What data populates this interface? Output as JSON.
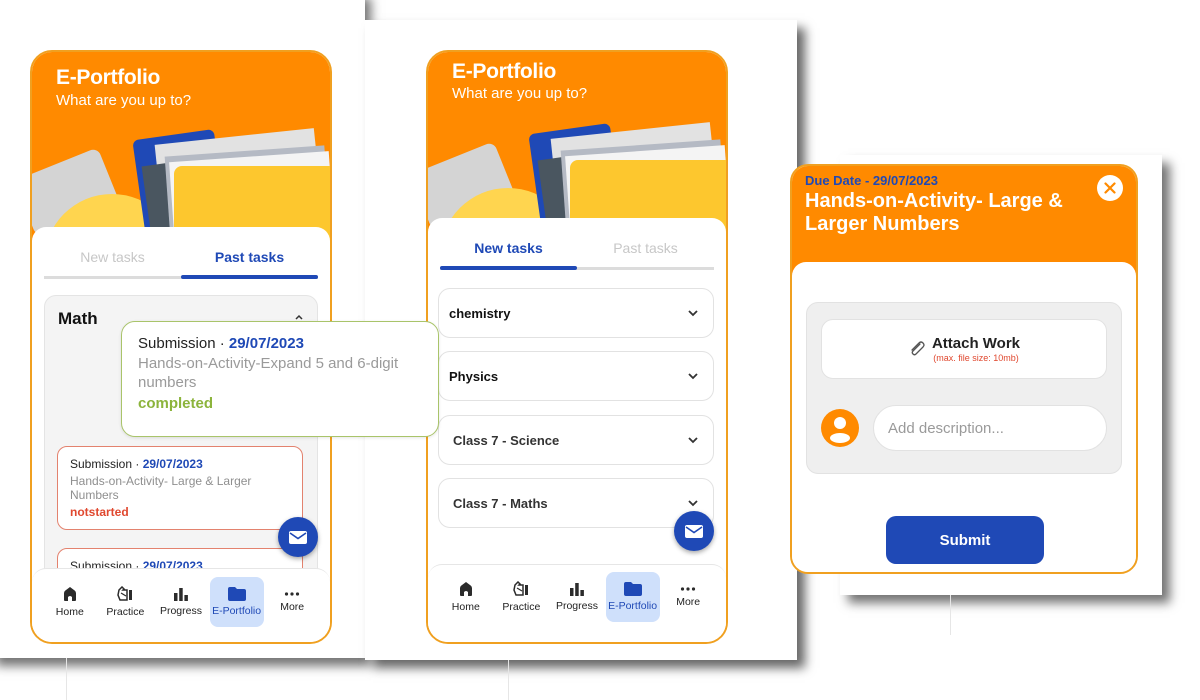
{
  "screens": [
    {
      "header": {
        "title": "E-Portfolio",
        "subtitle": "What are you up to?"
      },
      "tabs": [
        {
          "label": "New tasks",
          "active": false
        },
        {
          "label": "Past tasks",
          "active": true
        }
      ],
      "section": {
        "title": "Math",
        "expanded": true,
        "submissions": [
          {
            "prefix": "Submission · ",
            "date": "29/07/2023",
            "name": "Hands-on-Activity-Expand 5 and 6-digit numbers",
            "status": "completed"
          },
          {
            "prefix": "Submission · ",
            "date": "29/07/2023",
            "name": "Hands-on-Activity- Large & Larger Numbers",
            "status": "notstarted"
          },
          {
            "prefix": "Submission · ",
            "date": "29/07/2023",
            "name": "",
            "status": ""
          }
        ]
      },
      "fab_icon": "mail-icon"
    },
    {
      "header": {
        "title": "E-Portfolio",
        "subtitle": "What are you up to?"
      },
      "tabs": [
        {
          "label": "New tasks",
          "active": true
        },
        {
          "label": "Past tasks",
          "active": false
        }
      ],
      "subjects": [
        {
          "label": "chemistry"
        },
        {
          "label": "Physics"
        },
        {
          "label": "Class 7 - Science"
        },
        {
          "label": "Class 7 - Maths"
        }
      ],
      "fab_icon": "mail-icon"
    }
  ],
  "bottom_nav": [
    {
      "label": "Home",
      "icon": "home-icon",
      "active": false
    },
    {
      "label": "Practice",
      "icon": "practice-icon",
      "active": false
    },
    {
      "label": "Progress",
      "icon": "bar-chart-icon",
      "active": false
    },
    {
      "label": "E-Portfolio",
      "icon": "folder-icon",
      "active": true
    },
    {
      "label": "More",
      "icon": "more-dots-icon",
      "active": false
    }
  ],
  "modal": {
    "due_date": "Due Date - 29/07/2023",
    "title": "Hands-on-Activity- Large & Larger Numbers",
    "attach_label": "Attach Work",
    "attach_note": "(max. file size: 10mb)",
    "description_placeholder": "Add description...",
    "description_value": "",
    "submit_label": "Submit"
  },
  "colors": {
    "primary_orange": "#ff8a00",
    "primary_blue": "#1f49b6",
    "status_completed": "#8cb43c",
    "status_notstarted": "#e0482f",
    "nav_active_bg": "#cfe0fb"
  }
}
